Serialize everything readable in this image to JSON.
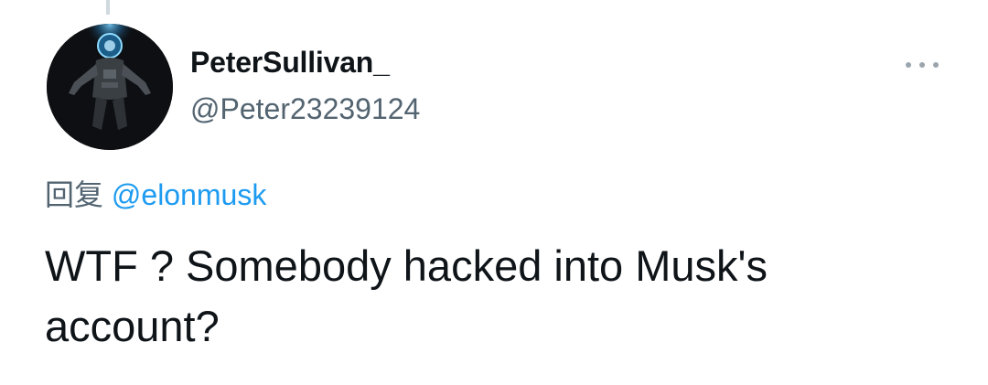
{
  "tweet": {
    "display_name": "PeterSullivan_",
    "handle": "@Peter23239124",
    "reply_prefix": "回复",
    "reply_to": "@elonmusk",
    "text": "WTF ? Somebody hacked into Musk's account?",
    "more_icon": "more-horizontal-icon",
    "avatar_icon": "astronaut-avatar"
  },
  "colors": {
    "text_primary": "#0f1419",
    "text_secondary": "#536471",
    "link": "#1d9bf0",
    "thread_line": "#cfd9de"
  }
}
